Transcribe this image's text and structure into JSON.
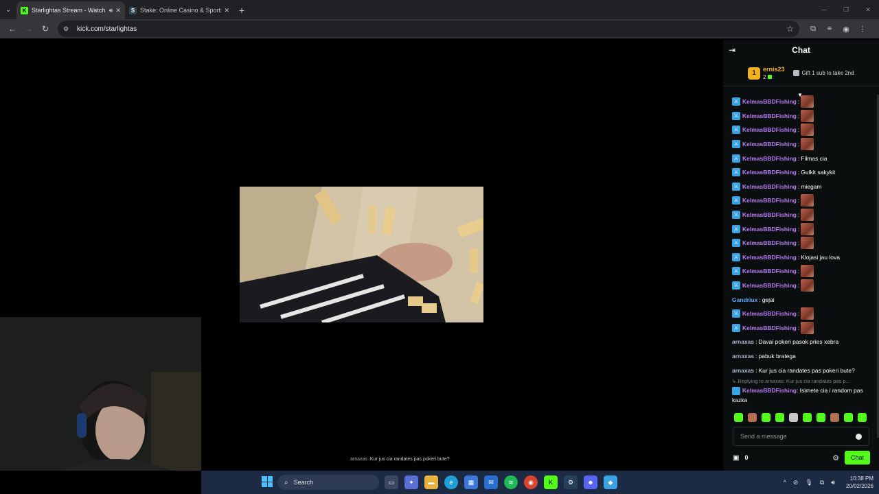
{
  "browser": {
    "tabs": [
      {
        "title": "Starlightas Stream - Watch Li",
        "favicon": "kick-logo",
        "active": true
      },
      {
        "title": "Stake: Online Casino & Sports B",
        "favicon": "stake-logo",
        "active": false
      }
    ],
    "url": "kick.com/starlightas"
  },
  "video": {
    "caption_user": "arnaxas",
    "caption_text": "Kur jus cia randates pas pokeri bute?"
  },
  "chat": {
    "title": "Chat",
    "pinned": {
      "rank": "1",
      "username": "ernis23",
      "count": "2",
      "gift_text": "Gift 1 sub to take 2nd"
    },
    "messages": [
      {
        "user": "KelmasBBDFishing",
        "color": "purple",
        "badge": true,
        "text": "",
        "emote": true
      },
      {
        "user": "KelmasBBDFishing",
        "color": "purple",
        "badge": true,
        "text": "",
        "emote": true
      },
      {
        "user": "KelmasBBDFishing",
        "color": "purple",
        "badge": true,
        "text": "",
        "emote": true
      },
      {
        "user": "KelmasBBDFishing",
        "color": "purple",
        "badge": true,
        "text": "",
        "emote": true
      },
      {
        "user": "KelmasBBDFishing",
        "color": "purple",
        "badge": true,
        "text": "Filmas cia",
        "emote": false
      },
      {
        "user": "KelmasBBDFishing",
        "color": "purple",
        "badge": true,
        "text": "Gulkit sakykit",
        "emote": false
      },
      {
        "user": "KelmasBBDFishing",
        "color": "purple",
        "badge": true,
        "text": "miegam",
        "emote": false
      },
      {
        "user": "KelmasBBDFishing",
        "color": "purple",
        "badge": true,
        "text": "",
        "emote": true
      },
      {
        "user": "KelmasBBDFishing",
        "color": "purple",
        "badge": true,
        "text": "",
        "emote": true
      },
      {
        "user": "KelmasBBDFishing",
        "color": "purple",
        "badge": true,
        "text": "",
        "emote": true
      },
      {
        "user": "KelmasBBDFishing",
        "color": "purple",
        "badge": true,
        "text": "",
        "emote": true
      },
      {
        "user": "KelmasBBDFishing",
        "color": "purple",
        "badge": true,
        "text": "Klojasi jau lova",
        "emote": false
      },
      {
        "user": "KelmasBBDFishing",
        "color": "purple",
        "badge": true,
        "text": "",
        "emote": true
      },
      {
        "user": "KelmasBBDFishing",
        "color": "purple",
        "badge": true,
        "text": "",
        "emote": true
      },
      {
        "user": "Gandriux",
        "color": "blue",
        "badge": false,
        "text": "gejai",
        "emote": false
      },
      {
        "user": "KelmasBBDFishing",
        "color": "purple",
        "badge": true,
        "text": "",
        "emote": true
      },
      {
        "user": "KelmasBBDFishing",
        "color": "purple",
        "badge": true,
        "text": "",
        "emote": true
      },
      {
        "user": "arnaxas",
        "color": "grey",
        "badge": false,
        "text": "Davai pokeri pasok pries xebra",
        "emote": false
      },
      {
        "user": "arnaxas",
        "color": "grey",
        "badge": false,
        "text": "pabuk bratega",
        "emote": false
      },
      {
        "user": "arnaxas",
        "color": "grey",
        "badge": false,
        "text": "Kur jus cia randates pas pokeri bute?",
        "emote": false
      }
    ],
    "reply": {
      "replying_to": "Replying to arnaxas: Kur jus cia randates pas p...",
      "user": "KelmasBBDFishing",
      "text": "Isimete cia i random pas kazka"
    },
    "input_placeholder": "Send a message",
    "points": "0",
    "send_label": "Chat"
  },
  "taskbar": {
    "search_label": "Search",
    "time": "10:38 PM",
    "date": "20/02/2026",
    "apps": [
      "task-view-icon",
      "copilot-icon",
      "file-explorer-icon",
      "edge-icon",
      "store-icon",
      "mail-icon",
      "spotify-icon",
      "chrome-icon",
      "kick-icon",
      "steam-icon",
      "discord-icon",
      "app-icon"
    ]
  },
  "colors": {
    "kick_green": "#53fc18",
    "purple_user": "#b77cf5",
    "taskbar": "#1d2a44"
  }
}
